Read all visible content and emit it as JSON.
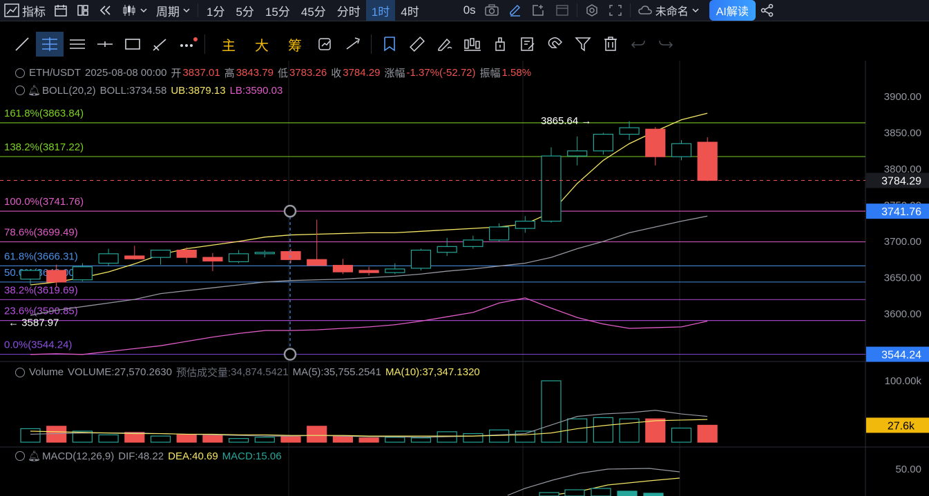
{
  "toolbar": {
    "indicators_label": "指标",
    "period_label": "周期",
    "intervals": [
      "1分",
      "5分",
      "15分",
      "45分",
      "分时",
      "1时",
      "4时"
    ],
    "active_interval": "1时",
    "replay_label": "0s",
    "layout_name": "未命名",
    "ai_label": "AI解读"
  },
  "drawing_tools": {
    "main_label": "主",
    "big_label": "大",
    "chip_label": "筹"
  },
  "ohlc": {
    "symbol": "ETH/USDT",
    "datetime": "2025-08-08 00:00",
    "open_label": "开",
    "open": "3837.01",
    "high_label": "高",
    "high": "3843.79",
    "low_label": "低",
    "low": "3783.26",
    "close_label": "收",
    "close": "3784.29",
    "change_label": "涨幅",
    "change": "-1.37%(-52.72)",
    "amplitude_label": "振幅",
    "amplitude": "1.58%"
  },
  "boll": {
    "name": "BOLL(20,2)",
    "mid": "BOLL:3734.58",
    "ub": "UB:3879.13",
    "lb": "LB:3590.03"
  },
  "fib_levels": [
    {
      "label": "161.8%(3863.84)",
      "price": 3863.84,
      "color": "#7ed321"
    },
    {
      "label": "138.2%(3817.22)",
      "price": 3817.22,
      "color": "#7ed321"
    },
    {
      "label": "100.0%(3741.76)",
      "price": 3741.76,
      "color": "#e05cc7"
    },
    {
      "label": "78.6%(3699.49)",
      "price": 3699.49,
      "color": "#e05cc7"
    },
    {
      "label": "61.8%(3666.31)",
      "price": 3666.31,
      "color": "#4a8fe7"
    },
    {
      "label": "50.0%(3648.00)",
      "price": 3644.0,
      "color": "#4a8fe7"
    },
    {
      "label": "38.2%(3619.69)",
      "price": 3619.69,
      "color": "#b84fe0"
    },
    {
      "label": "23.6%(3590.85)",
      "price": 3590.85,
      "color": "#b84fe0"
    },
    {
      "label": "0.0%(3544.24)",
      "price": 3544.24,
      "color": "#8a4fe0"
    }
  ],
  "annotations": {
    "high_mark": "3865.64",
    "low_mark": "3587.97"
  },
  "price_axis": {
    "ticks": [
      "3900.00",
      "3850.00",
      "3800.00",
      "3750.00",
      "3700.00",
      "3650.00",
      "3600.00"
    ],
    "current_price": "3784.29",
    "fib_top_tag": "3741.76",
    "fib_bottom_tag": "3544.24"
  },
  "volume": {
    "name": "Volume",
    "volume": "VOLUME:27,570.2630",
    "estimate_label": "预估成交量:",
    "estimate": "34,874.5421",
    "ma5": "MA(5):35,755.2541",
    "ma10": "MA(10):37,347.1320",
    "axis_tick": "100.00k",
    "current_tag": "27.6k"
  },
  "macd": {
    "name": "MACD(12,26,9)",
    "dif": "DIF:48.22",
    "dea": "DEA:40.69",
    "macd": "MACD:15.06",
    "axis_tick": "50.00"
  },
  "colors": {
    "up": "#26a69a",
    "down": "#ef5350",
    "boll_mid": "#f5e663",
    "boll_up": "#9598a1",
    "boll_low": "#e05cc7",
    "accent": "#2f7bf5"
  },
  "chart_data": {
    "type": "candlestick",
    "timeframe": "1时",
    "candles": [
      {
        "o": 3648,
        "h": 3662,
        "l": 3640,
        "c": 3660
      },
      {
        "o": 3660,
        "h": 3668,
        "l": 3637,
        "c": 3644
      },
      {
        "o": 3647,
        "h": 3670,
        "l": 3645,
        "c": 3665
      },
      {
        "o": 3670,
        "h": 3690,
        "l": 3666,
        "c": 3683
      },
      {
        "o": 3680,
        "h": 3694,
        "l": 3675,
        "c": 3676
      },
      {
        "o": 3678,
        "h": 3686,
        "l": 3668,
        "c": 3688
      },
      {
        "o": 3688,
        "h": 3692,
        "l": 3670,
        "c": 3678
      },
      {
        "o": 3678,
        "h": 3684,
        "l": 3659,
        "c": 3673
      },
      {
        "o": 3672,
        "h": 3688,
        "l": 3670,
        "c": 3683
      },
      {
        "o": 3683,
        "h": 3688,
        "l": 3678,
        "c": 3685
      },
      {
        "o": 3686,
        "h": 3690,
        "l": 3670,
        "c": 3675
      },
      {
        "o": 3675,
        "h": 3730,
        "l": 3668,
        "c": 3667
      },
      {
        "o": 3667,
        "h": 3676,
        "l": 3655,
        "c": 3658
      },
      {
        "o": 3660,
        "h": 3665,
        "l": 3653,
        "c": 3657
      },
      {
        "o": 3657,
        "h": 3670,
        "l": 3655,
        "c": 3662
      },
      {
        "o": 3663,
        "h": 3690,
        "l": 3660,
        "c": 3688
      },
      {
        "o": 3685,
        "h": 3705,
        "l": 3680,
        "c": 3693
      },
      {
        "o": 3693,
        "h": 3708,
        "l": 3690,
        "c": 3702
      },
      {
        "o": 3702,
        "h": 3725,
        "l": 3700,
        "c": 3720
      },
      {
        "o": 3718,
        "h": 3735,
        "l": 3712,
        "c": 3728
      },
      {
        "o": 3728,
        "h": 3830,
        "l": 3726,
        "c": 3818
      },
      {
        "o": 3818,
        "h": 3845,
        "l": 3805,
        "c": 3825
      },
      {
        "o": 3825,
        "h": 3850,
        "l": 3820,
        "c": 3848
      },
      {
        "o": 3848,
        "h": 3866,
        "l": 3840,
        "c": 3857
      },
      {
        "o": 3855,
        "h": 3858,
        "l": 3805,
        "c": 3817
      },
      {
        "o": 3817,
        "h": 3840,
        "l": 3812,
        "c": 3835
      },
      {
        "o": 3837.01,
        "h": 3843.79,
        "l": 3783.26,
        "c": 3784.29
      }
    ],
    "boll_mid": [
      3640,
      3644,
      3650,
      3658,
      3669,
      3682,
      3690,
      3695,
      3700,
      3706,
      3709,
      3710,
      3711,
      3712,
      3712,
      3714,
      3716,
      3718,
      3720,
      3724,
      3740,
      3780,
      3812,
      3835,
      3852,
      3868,
      3877
    ],
    "boll_upper": [
      3598,
      3605,
      3610,
      3615,
      3620,
      3628,
      3632,
      3636,
      3640,
      3644,
      3646,
      3647,
      3648,
      3650,
      3652,
      3655,
      3659,
      3662,
      3666,
      3670,
      3678,
      3690,
      3700,
      3712,
      3720,
      3728,
      3735
    ],
    "boll_lower": [
      3544,
      3545,
      3544,
      3548,
      3552,
      3556,
      3562,
      3568,
      3573,
      3577,
      3577,
      3578,
      3580,
      3582,
      3585,
      3590,
      3596,
      3602,
      3615,
      3622,
      3608,
      3595,
      3586,
      3580,
      3581,
      3582,
      3590
    ],
    "volume": [
      22,
      26,
      18,
      12,
      16,
      10,
      12,
      11,
      6,
      8,
      9,
      26,
      10,
      7,
      8,
      7,
      17,
      14,
      20,
      18,
      100,
      38,
      40,
      38,
      38,
      23,
      27.6
    ],
    "volume_ma": [
      13,
      14,
      15,
      15,
      15,
      14,
      13,
      12,
      11,
      10,
      10,
      11,
      10,
      9,
      9,
      8,
      9,
      10,
      12,
      14,
      28,
      42,
      46,
      48,
      52,
      46,
      42
    ],
    "volume_ma10": [
      18,
      17,
      16,
      15,
      14,
      14,
      13,
      13,
      12,
      12,
      11,
      11,
      11,
      10,
      10,
      10,
      10,
      10,
      11,
      12,
      15,
      22,
      27,
      31,
      35,
      36,
      37
    ],
    "ylim": [
      3540,
      3920
    ]
  }
}
